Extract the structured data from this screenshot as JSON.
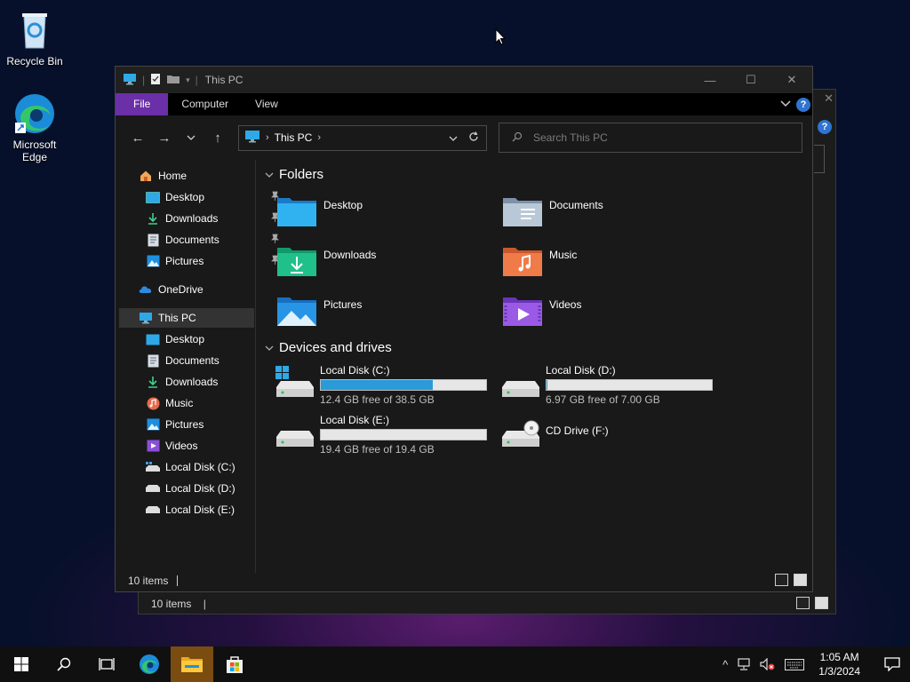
{
  "desktop": {
    "icons": [
      {
        "label": "Recycle Bin"
      },
      {
        "label": "Microsoft Edge"
      }
    ]
  },
  "background_window": {
    "status_count": "10 items"
  },
  "window": {
    "title": "This PC",
    "controls": {
      "minimize": "—",
      "maximize": "☐",
      "close": "✕"
    }
  },
  "ribbon": {
    "tabs": [
      {
        "label": "File"
      },
      {
        "label": "Computer"
      },
      {
        "label": "View"
      }
    ],
    "help": "?"
  },
  "nav": {
    "back": "←",
    "forward": "→",
    "recent": "⌄",
    "up": "↑"
  },
  "address": {
    "crumb": "This PC",
    "sep_before": "›",
    "sep_after": "›"
  },
  "search": {
    "placeholder": "Search This PC"
  },
  "sidebar": {
    "items": [
      {
        "label": "Home",
        "icon": "home-icon"
      },
      {
        "label": "Desktop",
        "icon": "desktop-icon",
        "pinned": true
      },
      {
        "label": "Downloads",
        "icon": "download-icon",
        "pinned": true
      },
      {
        "label": "Documents",
        "icon": "document-icon",
        "pinned": true
      },
      {
        "label": "Pictures",
        "icon": "pictures-icon",
        "pinned": true
      },
      {
        "label": "OneDrive",
        "icon": "cloud-icon"
      },
      {
        "label": "This PC",
        "icon": "computer-icon",
        "selected": true
      },
      {
        "label": "Desktop",
        "icon": "desktop-icon"
      },
      {
        "label": "Documents",
        "icon": "document-icon"
      },
      {
        "label": "Downloads",
        "icon": "download-icon"
      },
      {
        "label": "Music",
        "icon": "music-icon"
      },
      {
        "label": "Pictures",
        "icon": "pictures-icon"
      },
      {
        "label": "Videos",
        "icon": "video-icon"
      },
      {
        "label": "Local Disk (C:)",
        "icon": "drive-icon"
      },
      {
        "label": "Local Disk (D:)",
        "icon": "drive-icon"
      },
      {
        "label": "Local Disk (E:)",
        "icon": "drive-icon"
      }
    ]
  },
  "folders": {
    "header": "Folders",
    "items": [
      {
        "label": "Desktop",
        "icon": "desktop-folder-icon"
      },
      {
        "label": "Documents",
        "icon": "documents-folder-icon"
      },
      {
        "label": "Downloads",
        "icon": "downloads-folder-icon"
      },
      {
        "label": "Music",
        "icon": "music-folder-icon"
      },
      {
        "label": "Pictures",
        "icon": "pictures-folder-icon"
      },
      {
        "label": "Videos",
        "icon": "videos-folder-icon"
      }
    ]
  },
  "drives": {
    "header": "Devices and drives",
    "items": [
      {
        "label": "Local Disk (C:)",
        "free_text": "12.4 GB free of 38.5 GB",
        "used_fraction": 0.68
      },
      {
        "label": "Local Disk (D:)",
        "free_text": "6.97 GB free of 7.00 GB",
        "used_fraction": 0.004
      },
      {
        "label": "Local Disk (E:)",
        "free_text": "19.4 GB free of 19.4 GB",
        "used_fraction": 0.0
      },
      {
        "label": "CD Drive (F:)"
      }
    ]
  },
  "status": {
    "count": "10 items"
  },
  "taskbar": {
    "clock_time": "1:05 AM",
    "clock_date": "1/3/2024",
    "tray_chevron": "^"
  },
  "colors": {
    "accent_file_tab": "#6b2fa8",
    "drive_bar_fill": "#2a9ad9",
    "taskbar_active": "#7a4c10"
  }
}
